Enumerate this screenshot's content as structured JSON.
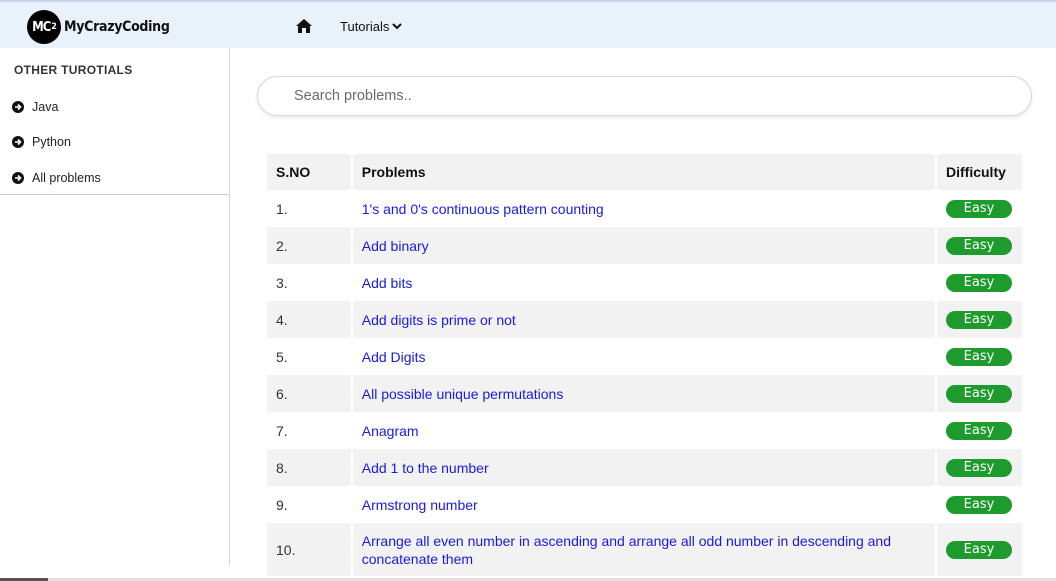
{
  "header": {
    "logo_badge": "MC",
    "logo_badge_sup": "2",
    "logo_text": "MyCrazyCoding",
    "nav_tutorials": "Tutorials"
  },
  "sidebar": {
    "heading": "OTHER TUROTIALS",
    "items": [
      {
        "label": "Java"
      },
      {
        "label": "Python"
      },
      {
        "label": "All problems"
      }
    ]
  },
  "search": {
    "placeholder": "Search problems.."
  },
  "table": {
    "headers": {
      "sno": "S.NO",
      "problems": "Problems",
      "difficulty": "Difficulty"
    },
    "rows": [
      {
        "sno": "1.",
        "problem": "1's and 0's continuous pattern counting",
        "difficulty": "Easy"
      },
      {
        "sno": "2.",
        "problem": "Add binary",
        "difficulty": "Easy"
      },
      {
        "sno": "3.",
        "problem": "Add bits",
        "difficulty": "Easy"
      },
      {
        "sno": "4.",
        "problem": "Add digits is prime or not",
        "difficulty": "Easy"
      },
      {
        "sno": "5.",
        "problem": "Add Digits",
        "difficulty": "Easy"
      },
      {
        "sno": "6.",
        "problem": "All possible unique permutations",
        "difficulty": "Easy"
      },
      {
        "sno": "7.",
        "problem": "Anagram",
        "difficulty": "Easy"
      },
      {
        "sno": "8.",
        "problem": "Add 1 to the number",
        "difficulty": "Easy"
      },
      {
        "sno": "9.",
        "problem": "Armstrong number",
        "difficulty": "Easy"
      },
      {
        "sno": "10.",
        "problem": "Arrange all even number in ascending and arrange all odd number in descending and concatenate them",
        "difficulty": "Easy"
      }
    ]
  },
  "colors": {
    "link": "#1a1ae0",
    "easy_badge": "#1e9b2d",
    "topbar": "#e9f1fb",
    "row_stripe": "#f2f2f2"
  },
  "icons": {
    "home": "home-icon",
    "dropdown": "chevron-down-icon",
    "sidebar_bullet": "arrow-circle-right-icon"
  }
}
